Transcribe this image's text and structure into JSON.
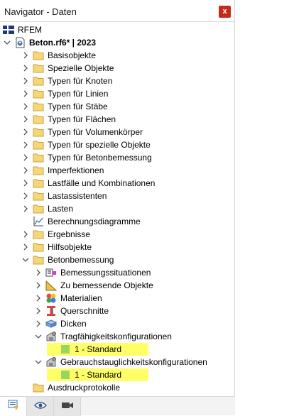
{
  "window": {
    "title": "Navigator - Daten",
    "close_label": "x"
  },
  "colors": {
    "highlight": "#ffff66",
    "folder": "#f5d77a",
    "close": "#c42b1c"
  },
  "tree": {
    "rfem": "RFEM",
    "model": "Beton.rf6* | 2023",
    "items": [
      "Basisobjekte",
      "Spezielle Objekte",
      "Typen für Knoten",
      "Typen für Linien",
      "Typen für Stäbe",
      "Typen für Flächen",
      "Typen für Volumenkörper",
      "Typen für spezielle Objekte",
      "Typen für Betonbemessung",
      "Imperfektionen",
      "Lastfälle und Kombinationen",
      "Lastassistenten",
      "Lasten",
      "Berechnungsdiagramme",
      "Ergebnisse",
      "Hilfsobjekte",
      "Betonbemessung"
    ],
    "concrete_children": [
      "Bemessungssituationen",
      "Zu bemessende Objekte",
      "Materialien",
      "Querschnitte",
      "Dicken",
      "Tragfähigkeitskonfigurationen",
      "Gebrauchstauglichkeitskonfigurationen"
    ],
    "uls_standard": "1 - Standard",
    "sls_standard": "1 - Standard",
    "print": "Ausdruckprotokolle"
  },
  "bottom_tabs": [
    "data-tab-icon",
    "eye-icon",
    "camera-icon"
  ]
}
